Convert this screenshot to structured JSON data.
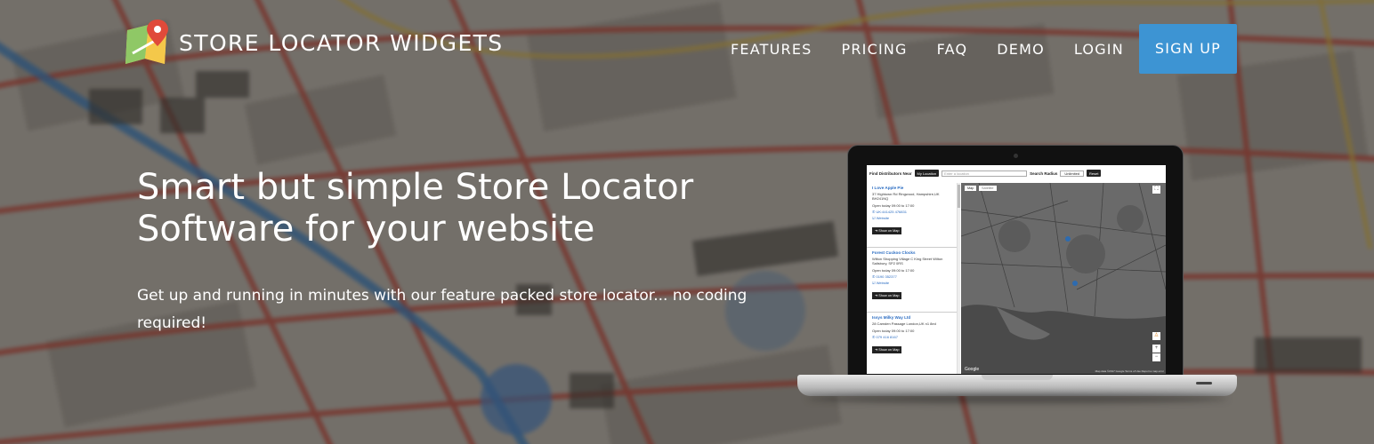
{
  "header": {
    "brand": "STORE LOCATOR WIDGETS",
    "nav": [
      "FEATURES",
      "PRICING",
      "FAQ",
      "DEMO",
      "LOGIN"
    ],
    "signup": "SIGN UP"
  },
  "hero": {
    "title": "Smart but simple Store Locator Software for your website",
    "subtitle": "Get up and running in minutes with our feature packed store locator... no coding required!"
  },
  "widget": {
    "find_label": "Find Distributors Near",
    "my_location": "My Location",
    "location_placeholder": "Enter a location",
    "radius_label": "Search Radius",
    "radius_value": "Unlimited",
    "reset": "Reset",
    "map_tab": "Map",
    "satellite_tab": "Satellite",
    "google": "Google",
    "attribution": "Map data ©2017 Google   Terms of Use   Report a map error",
    "stores": [
      {
        "name": "I Love Apple Pie",
        "address": "37 Hightown Rd Ringwood, Hampshire,UK BH241NQ",
        "hours": "Open today 09:00 to 17:00",
        "phone": "UK:441425 476831",
        "web": "Website",
        "button": "Show on Map"
      },
      {
        "name": "Forest Cuckoo Clocks",
        "address": "Wilton Shopping Village C King Street Wilton Salisbury, SP2 0RS",
        "hours": "Open today 09:00 to 17:00",
        "phone": "0190 352377",
        "web": "Website",
        "button": "Show on Map"
      },
      {
        "name": "Issys Milky Way Ltd",
        "address": "28 Camden Passage London,UK n1 8ed",
        "hours": "Open today 09:00 to 17:00",
        "phone": "079 416 8167",
        "web": "",
        "button": "Show on Map"
      }
    ]
  },
  "colors": {
    "accent": "#3d94d3",
    "link": "#2a6cc2"
  }
}
